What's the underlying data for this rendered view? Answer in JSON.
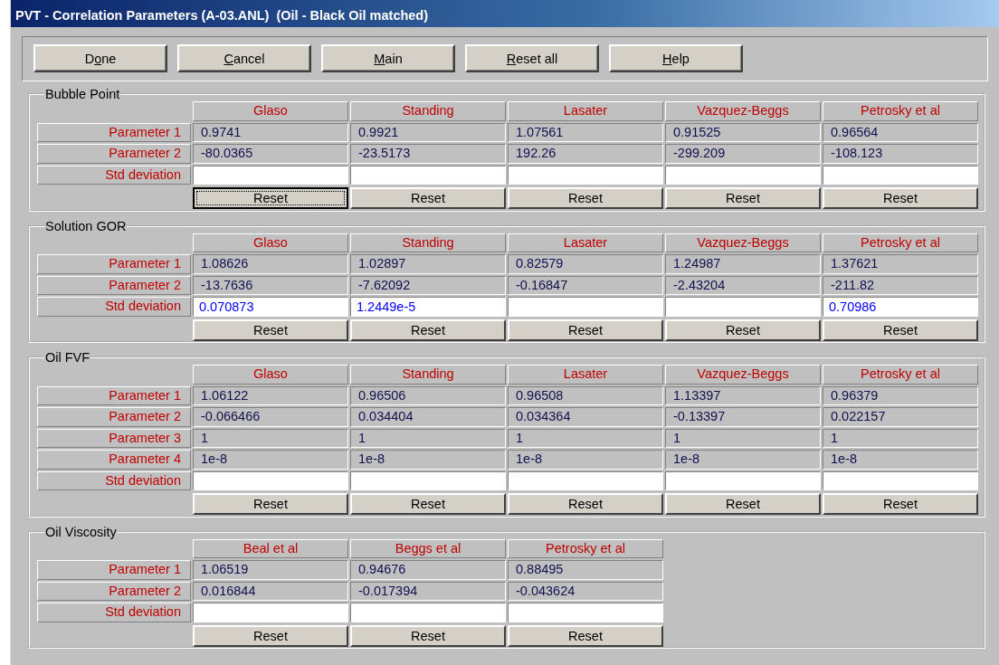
{
  "window": {
    "title": "PVT - Correlation Parameters (A-03.ANL)  (Oil - Black Oil matched)"
  },
  "buttons": [
    {
      "before": "D",
      "key": "o",
      "after": "ne"
    },
    {
      "key": "C",
      "after": "ancel"
    },
    {
      "key": "M",
      "after": "ain"
    },
    {
      "key": "R",
      "after": "eset all"
    },
    {
      "key": "H",
      "after": "elp"
    }
  ],
  "sections": [
    {
      "title": "Bubble Point",
      "std_label": "Std deviation",
      "methods": [
        {
          "name": "Glaso",
          "reset": "Reset",
          "focused": true
        },
        {
          "name": "Standing",
          "reset": "Reset",
          "focused": false
        },
        {
          "name": "Lasater",
          "reset": "Reset",
          "focused": false
        },
        {
          "name": "Vazquez-Beggs",
          "reset": "Reset",
          "focused": false
        },
        {
          "name": "Petrosky et al",
          "reset": "Reset",
          "focused": false
        }
      ],
      "rows": [
        {
          "label": "Parameter 1",
          "values": [
            "0.9741",
            "0.9921",
            "1.07561",
            "0.91525",
            "0.96564"
          ]
        },
        {
          "label": "Parameter 2",
          "values": [
            "-80.0365",
            "-23.5173",
            "192.26",
            "-299.209",
            "-108.123"
          ]
        }
      ]
    },
    {
      "title": "Solution GOR",
      "std_label": "Std deviation",
      "methods": [
        {
          "name": "Glaso",
          "reset": "Reset",
          "focused": false,
          "std_deviation": "0.070873"
        },
        {
          "name": "Standing",
          "reset": "Reset",
          "focused": false,
          "std_deviation": "1.2449e-5"
        },
        {
          "name": "Lasater",
          "reset": "Reset",
          "focused": false
        },
        {
          "name": "Vazquez-Beggs",
          "reset": "Reset",
          "focused": false
        },
        {
          "name": "Petrosky et al",
          "reset": "Reset",
          "focused": false,
          "std_deviation": "0.70986"
        }
      ],
      "rows": [
        {
          "label": "Parameter 1",
          "values": [
            "1.08626",
            "1.02897",
            "0.82579",
            "1.24987",
            "1.37621"
          ]
        },
        {
          "label": "Parameter 2",
          "values": [
            "-13.7636",
            "-7.62092",
            "-0.16847",
            "-2.43204",
            "-211.82"
          ]
        }
      ]
    },
    {
      "title": "Oil FVF",
      "std_label": "Std deviation",
      "methods": [
        {
          "name": "Glaso",
          "reset": "Reset",
          "focused": false
        },
        {
          "name": "Standing",
          "reset": "Reset",
          "focused": false
        },
        {
          "name": "Lasater",
          "reset": "Reset",
          "focused": false
        },
        {
          "name": "Vazquez-Beggs",
          "reset": "Reset",
          "focused": false
        },
        {
          "name": "Petrosky et al",
          "reset": "Reset",
          "focused": false
        }
      ],
      "rows": [
        {
          "label": "Parameter 1",
          "values": [
            "1.06122",
            "0.96506",
            "0.96508",
            "1.13397",
            "0.96379"
          ]
        },
        {
          "label": "Parameter 2",
          "values": [
            "-0.066466",
            "0.034404",
            "0.034364",
            "-0.13397",
            "0.022157"
          ]
        },
        {
          "label": "Parameter 3",
          "values": [
            "1",
            "1",
            "1",
            "1",
            "1"
          ]
        },
        {
          "label": "Parameter 4",
          "values": [
            "1e-8",
            "1e-8",
            "1e-8",
            "1e-8",
            "1e-8"
          ]
        }
      ]
    },
    {
      "title": "Oil Viscosity",
      "std_label": "Std deviation",
      "methods": [
        {
          "name": "Beal et al",
          "reset": "Reset",
          "focused": false
        },
        {
          "name": "Beggs et al",
          "reset": "Reset",
          "focused": false
        },
        {
          "name": "Petrosky et al",
          "reset": "Reset",
          "focused": false
        }
      ],
      "rows": [
        {
          "label": "Parameter 1",
          "values": [
            "1.06519",
            "0.94676",
            "0.88495"
          ]
        },
        {
          "label": "Parameter 2",
          "values": [
            "0.016844",
            "-0.017394",
            "-0.043624"
          ]
        }
      ]
    }
  ]
}
